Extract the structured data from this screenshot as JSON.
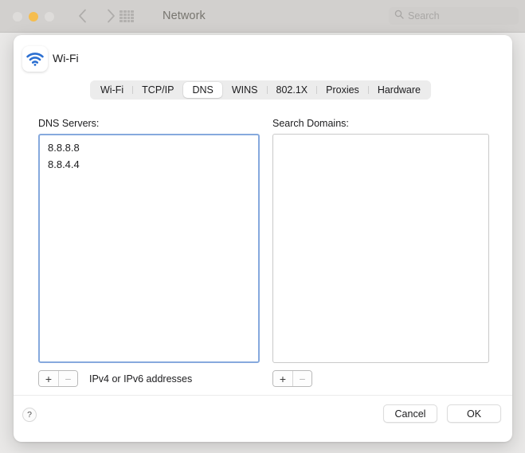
{
  "window": {
    "title": "Network",
    "traffic_lights": [
      "close",
      "minimize",
      "maximize"
    ],
    "back_label": "Back",
    "forward_label": "Forward",
    "grid_label": "All preferences",
    "search": {
      "placeholder": "Search",
      "value": ""
    }
  },
  "sheet": {
    "service_icon": "wifi-icon",
    "service_name": "Wi-Fi",
    "tabs": [
      {
        "label": "Wi-Fi",
        "selected": false
      },
      {
        "label": "TCP/IP",
        "selected": false
      },
      {
        "label": "DNS",
        "selected": true
      },
      {
        "label": "WINS",
        "selected": false
      },
      {
        "label": "802.1X",
        "selected": false
      },
      {
        "label": "Proxies",
        "selected": false
      },
      {
        "label": "Hardware",
        "selected": false
      }
    ],
    "dns": {
      "label": "DNS Servers:",
      "servers": [
        "8.8.8.8",
        "8.8.4.4"
      ],
      "add_label": "+",
      "remove_label": "−",
      "hint": "IPv4 or IPv6 addresses"
    },
    "search_domains": {
      "label": "Search Domains:",
      "domains": [],
      "add_label": "+",
      "remove_label": "−"
    },
    "footer": {
      "help_label": "?",
      "cancel_label": "Cancel",
      "ok_label": "OK"
    }
  },
  "colors": {
    "accent_blue": "#2b7bd6",
    "focus_ring": "#86a9dd",
    "traffic_minimize": "#f5bd4f",
    "traffic_inactive": "#dedcda",
    "window_chrome": "#d2d0ce",
    "sheet_background": "#ffffff"
  }
}
